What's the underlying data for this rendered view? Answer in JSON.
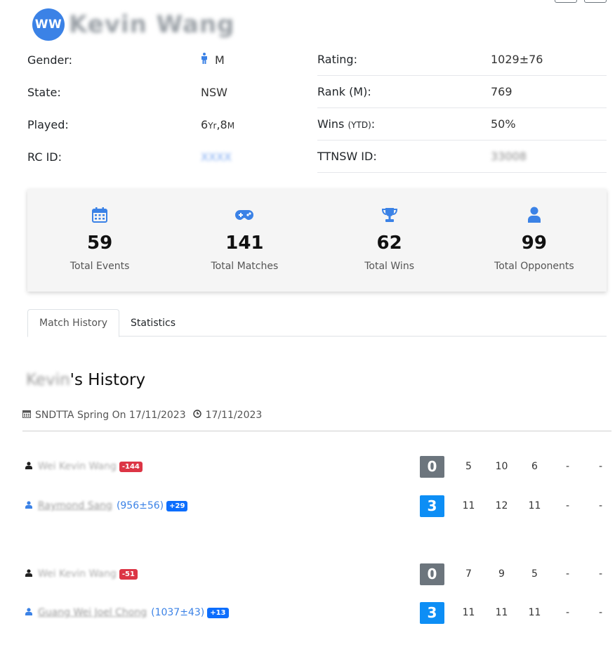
{
  "profile": {
    "initials": "WW",
    "name": "Kevin Wang"
  },
  "info": {
    "gender_label": "Gender:",
    "gender_value": "M",
    "rating_label": "Rating:",
    "rating_value": "1029±76",
    "state_label": "State:",
    "state_value": "NSW",
    "rank_label": "Rank (M):",
    "rank_value": "769",
    "played_label": "Played:",
    "played_years": "6",
    "played_yr_unit": "Yr",
    "played_months": ",8",
    "played_m_unit": "M",
    "wins_label": "Wins",
    "wins_sub": "(YTD)",
    "wins_colon": ":",
    "wins_value": "50%",
    "rcid_label": "RC ID:",
    "rcid_value": "XXXX",
    "ttnsw_label": "TTNSW ID:",
    "ttnsw_value": "33008"
  },
  "stats": [
    {
      "icon": "calendar-icon",
      "value": "59",
      "label": "Total Events"
    },
    {
      "icon": "gamepad-icon",
      "value": "141",
      "label": "Total Matches"
    },
    {
      "icon": "trophy-icon",
      "value": "62",
      "label": "Total Wins"
    },
    {
      "icon": "user-icon",
      "value": "99",
      "label": "Total Opponents"
    }
  ],
  "tabs": {
    "match_history": "Match History",
    "statistics": "Statistics"
  },
  "history": {
    "first_name": "Kevin",
    "title_suffix": "'s History"
  },
  "event": {
    "name": "SNDTTA Spring On 17/11/2023",
    "date": "17/11/2023"
  },
  "matches": [
    {
      "p1": {
        "name": "Wei Kevin Wang",
        "badge": "-144",
        "total": "0",
        "games": [
          "5",
          "10",
          "6",
          "-",
          "-"
        ]
      },
      "p2": {
        "name": "Raymond Sang",
        "rating": "(956±56)",
        "badge": "+29",
        "total": "3",
        "games": [
          "11",
          "12",
          "11",
          "-",
          "-"
        ]
      }
    },
    {
      "p1": {
        "name": "Wei Kevin Wang",
        "badge": "-51",
        "total": "0",
        "games": [
          "7",
          "9",
          "5",
          "-",
          "-"
        ]
      },
      "p2": {
        "name": "Guang Wei Joel Chong",
        "rating": "(1037±43)",
        "badge": "+13",
        "total": "3",
        "games": [
          "11",
          "11",
          "11",
          "-",
          "-"
        ]
      }
    }
  ],
  "colors": {
    "accent": "#3b82e6",
    "win": "#0d8ef5",
    "lose": "#6c757d",
    "badge_neg": "#dc3545",
    "badge_pos": "#0d6efd"
  }
}
